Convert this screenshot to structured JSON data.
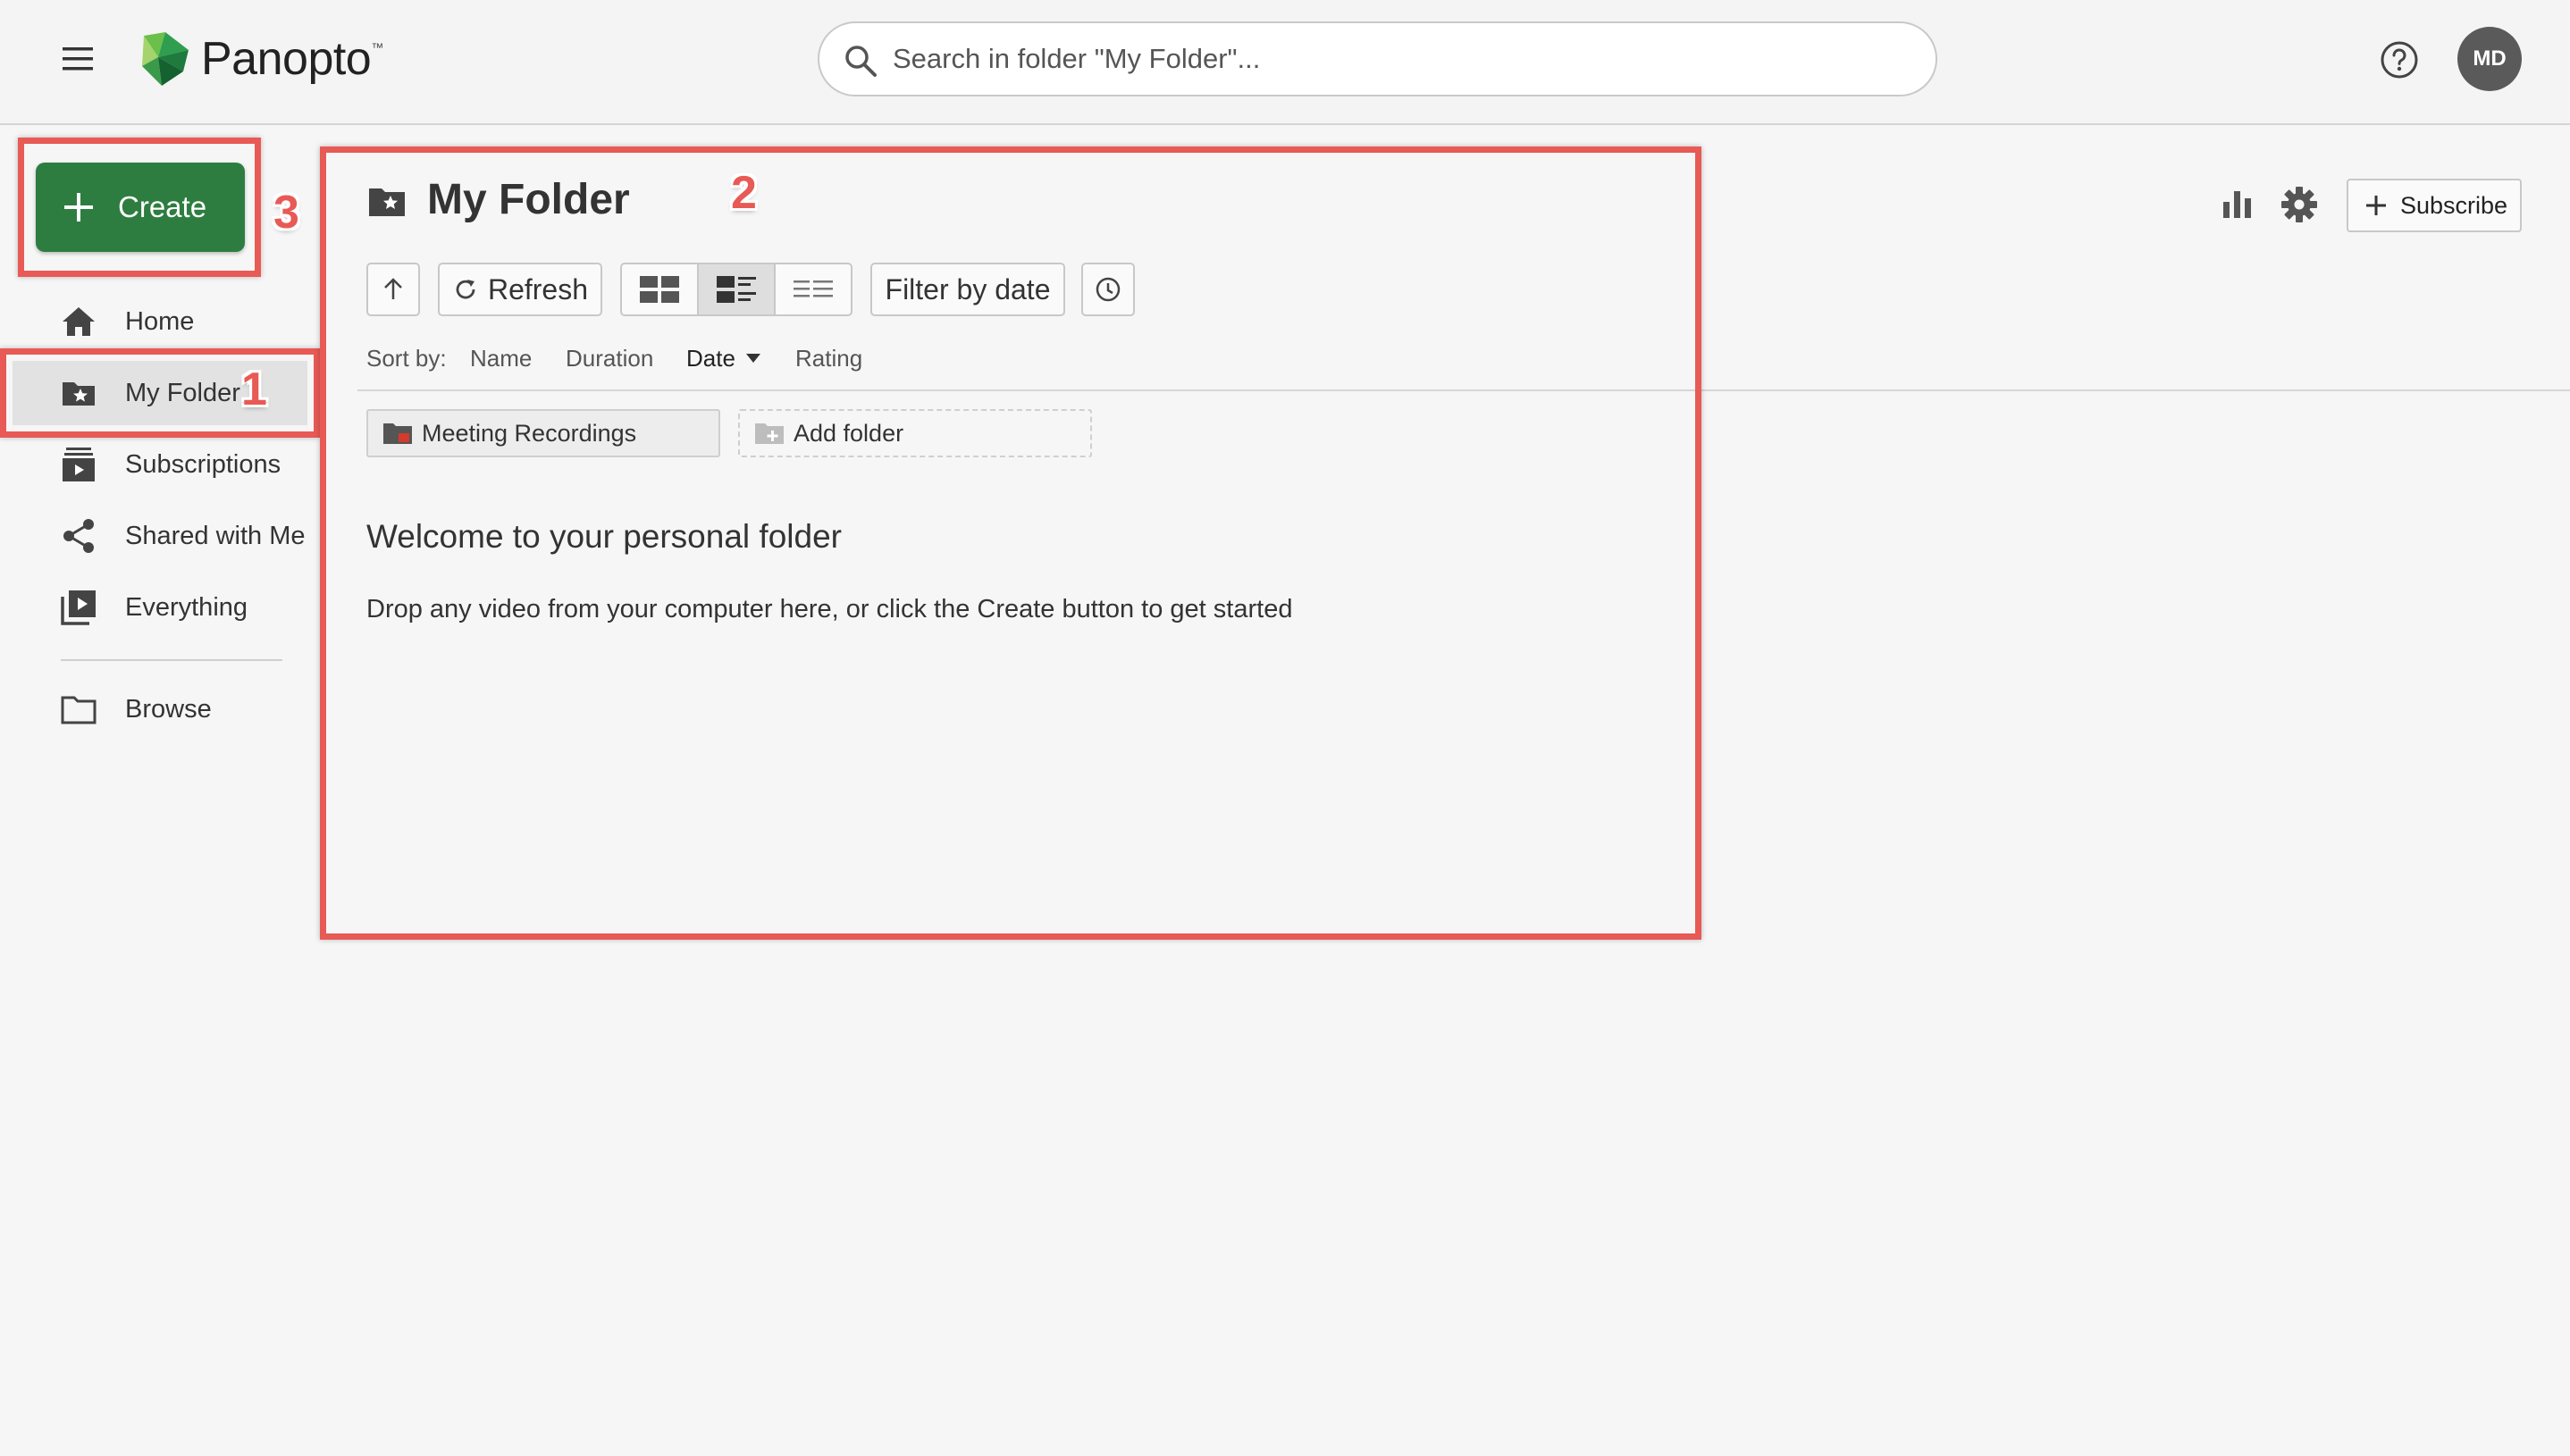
{
  "header": {
    "brand": "Panopto",
    "brand_tm": "™",
    "search_placeholder": "Search in folder \"My Folder\"...",
    "avatar_initials": "MD"
  },
  "sidebar": {
    "create_label": "Create",
    "items": [
      {
        "label": "Home",
        "icon": "home-icon"
      },
      {
        "label": "My Folder",
        "icon": "folder-star-icon",
        "active": true
      },
      {
        "label": "Subscriptions",
        "icon": "subscriptions-icon"
      },
      {
        "label": "Shared with Me",
        "icon": "share-icon"
      },
      {
        "label": "Everything",
        "icon": "video-library-icon"
      },
      {
        "label": "Browse",
        "icon": "folder-outline-icon"
      }
    ]
  },
  "main": {
    "title": "My Folder",
    "toolbar": {
      "refresh_label": "Refresh",
      "filter_label": "Filter by date",
      "views": [
        "grid-view-icon",
        "detail-view-icon",
        "list-view-icon"
      ],
      "active_view": "detail-view-icon"
    },
    "sort": {
      "label": "Sort by:",
      "options": [
        "Name",
        "Duration",
        "Date",
        "Rating"
      ],
      "active": "Date"
    },
    "folders": [
      {
        "label": "Meeting Recordings"
      }
    ],
    "add_folder_label": "Add folder",
    "welcome_title": "Welcome to your personal folder",
    "welcome_body": "Drop any video from your computer here, or click the Create button to get started",
    "subscribe_label": "Subscribe"
  },
  "annotations": {
    "labels": [
      "1",
      "2",
      "3"
    ],
    "color": "#e85a55"
  },
  "colors": {
    "create_green": "#2e7d40",
    "background": "#f6f6f6"
  }
}
